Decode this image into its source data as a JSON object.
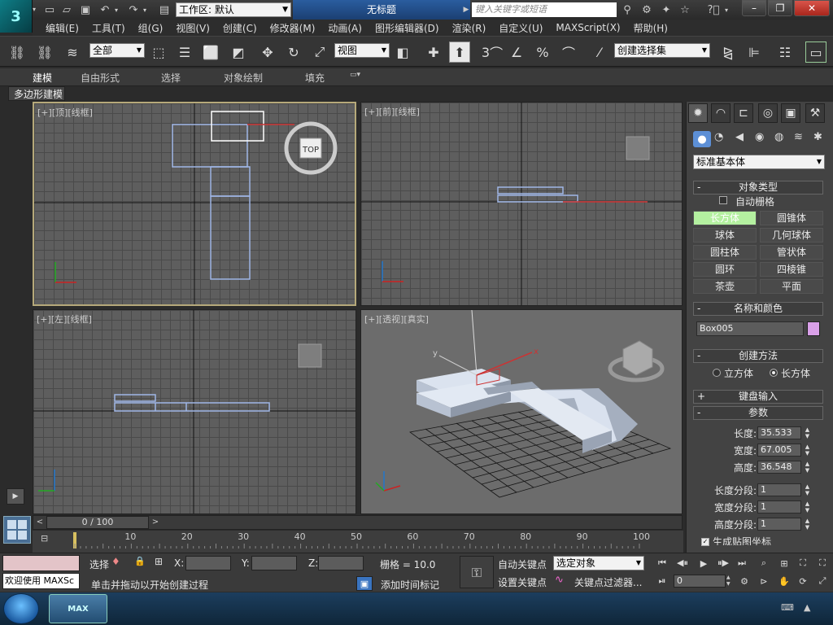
{
  "titlebar": {
    "workspace": "工作区: 默认",
    "document_title": "无标题",
    "search_placeholder": "键入关键字或短语"
  },
  "menu": [
    "编辑(E)",
    "工具(T)",
    "组(G)",
    "视图(V)",
    "创建(C)",
    "修改器(M)",
    "动画(A)",
    "图形编辑器(D)",
    "渲染(R)",
    "自定义(U)",
    "MAXScript(X)",
    "帮助(H)"
  ],
  "toolbar": {
    "selection_filter": "全部",
    "reference_coord": "视图",
    "snap_label": "3",
    "named_selection": "创建选择集"
  },
  "ribbon": {
    "tabs": [
      "建模",
      "自由形式",
      "选择",
      "对象绘制",
      "填充"
    ],
    "panel": "多边形建模"
  },
  "viewports": {
    "top": "[+][顶][线框]",
    "front": "[+][前][线框]",
    "left": "[+][左][线框]",
    "perspective": "[+][透视][真实]"
  },
  "command_panel": {
    "primitive_type": "标准基本体",
    "object_type_title": "对象类型",
    "autogrid": "自动栅格",
    "object_buttons": [
      "长方体",
      "圆锥体",
      "球体",
      "几何球体",
      "圆柱体",
      "管状体",
      "圆环",
      "四棱锥",
      "茶壶",
      "平面"
    ],
    "name_color_title": "名称和颜色",
    "object_name": "Box005",
    "object_color": "#d9a0e8",
    "creation_method_title": "创建方法",
    "method_cube": "立方体",
    "method_box": "长方体",
    "keyboard_entry_title": "键盘输入",
    "params_title": "参数",
    "length_label": "长度:",
    "length": "35.533",
    "width_label": "宽度:",
    "width": "67.005",
    "height_label": "高度:",
    "height": "36.548",
    "length_segs_label": "长度分段:",
    "length_segs": "1",
    "width_segs_label": "宽度分段:",
    "width_segs": "1",
    "height_segs_label": "高度分段:",
    "height_segs": "1",
    "gen_map_coords": "生成贴图坐标"
  },
  "timeline": {
    "frame_display": "0 / 100",
    "ticks": [
      "10",
      "20",
      "30",
      "40",
      "50",
      "60",
      "70",
      "80",
      "90",
      "100"
    ]
  },
  "status": {
    "maxscript_welcome": "欢迎使用 MAXSc",
    "select_label": "选择",
    "x_label": "X:",
    "y_label": "Y:",
    "z_label": "Z:",
    "grid": "栅格 = 10.0",
    "prompt": "单击并拖动以开始创建过程",
    "add_time_tag": "添加时间标记",
    "auto_key": "自动关键点",
    "set_key": "设置关键点",
    "key_mode": "选定对象",
    "key_filters": "关键点过滤器...",
    "current_frame": "0"
  },
  "taskbar": {
    "max_label": "MAX"
  }
}
